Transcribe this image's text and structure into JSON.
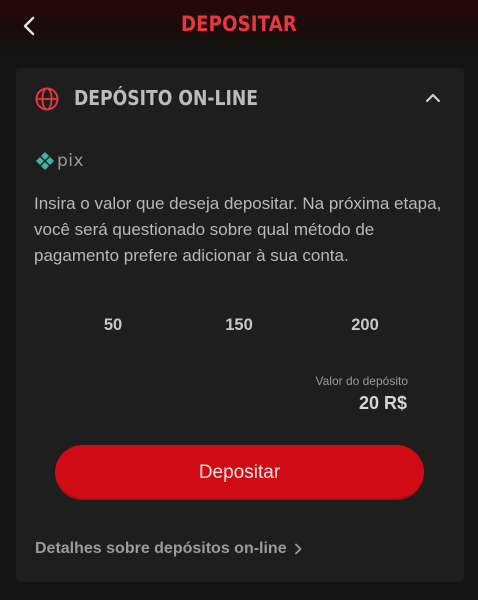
{
  "header": {
    "title": "DEPOSITAR"
  },
  "card": {
    "title": "DEPÓSITO ON-LINE",
    "pix_label": "pix",
    "description": "Insira o valor que deseja depositar. Na próxima etapa, você será questionado sobre qual método de pagamento prefere adicionar à sua conta.",
    "amounts": [
      "50",
      "150",
      "200"
    ],
    "deposit_value_label": "Valor do depósito",
    "deposit_value": "20 R$",
    "deposit_button": "Depositar",
    "details_link": "Detalhes sobre depósitos on-line"
  },
  "colors": {
    "accent": "#e8383d",
    "button": "#cf0b15",
    "background": "#141414",
    "card": "#1e1e1e"
  },
  "icons": {
    "back": "chevron-left-icon",
    "section": "globe-icon",
    "collapse": "chevron-up-icon",
    "pix": "pix-logo-icon",
    "link": "chevron-right-icon"
  }
}
